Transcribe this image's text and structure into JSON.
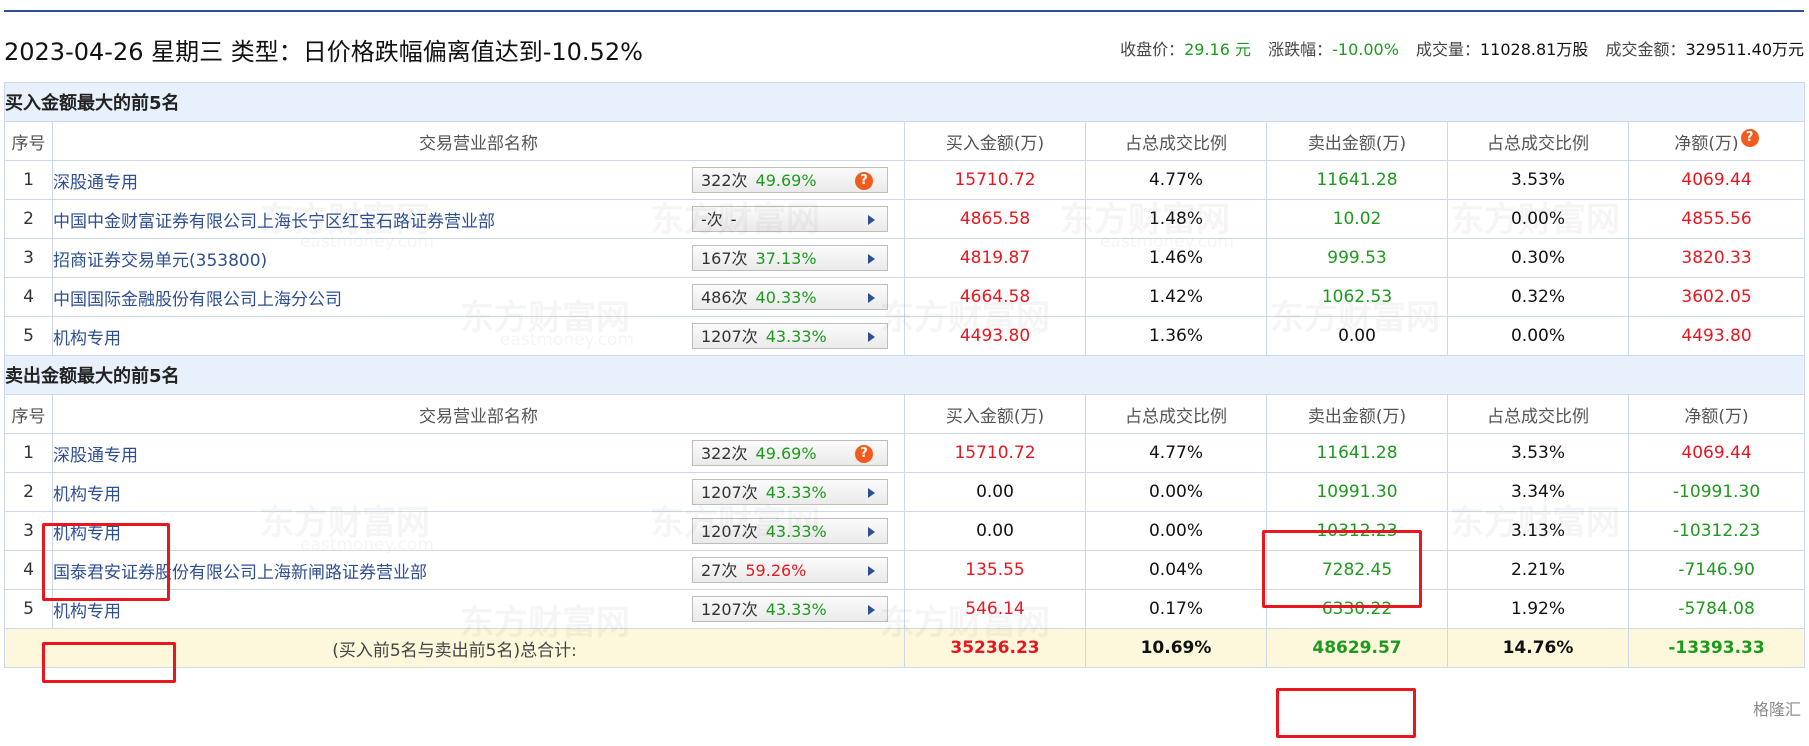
{
  "header": {
    "title": "2023-04-26 星期三 类型：日价格跌幅偏离值达到-10.52%",
    "close_label": "收盘价：",
    "close_value": "29.16 元",
    "change_label": "涨跌幅：",
    "change_value": "-10.00%",
    "volume_label": "成交量：",
    "volume_value": "11028.81万股",
    "amount_label": "成交金额：",
    "amount_value": "329511.40万元"
  },
  "columns": {
    "idx": "序号",
    "name": "交易营业部名称",
    "buy": "买入金额(万)",
    "buy_ratio": "占总成交比例",
    "sell": "卖出金额(万)",
    "sell_ratio": "占总成交比例",
    "net": "净额(万)"
  },
  "buy_section": {
    "title": "买入金额最大的前5名",
    "rows": [
      {
        "idx": "1",
        "name": "深股通专用",
        "count": "322次",
        "rate": "49.69%",
        "buy": "15710.72",
        "buy_ratio": "4.77%",
        "sell": "11641.28",
        "sell_ratio": "3.53%",
        "net": "4069.44"
      },
      {
        "idx": "2",
        "name": "中国中金财富证券有限公司上海长宁区红宝石路证券营业部",
        "count": "-次",
        "rate": "-",
        "buy": "4865.58",
        "buy_ratio": "1.48%",
        "sell": "10.02",
        "sell_ratio": "0.00%",
        "net": "4855.56"
      },
      {
        "idx": "3",
        "name": "招商证券交易单元(353800)",
        "count": "167次",
        "rate": "37.13%",
        "buy": "4819.87",
        "buy_ratio": "1.46%",
        "sell": "999.53",
        "sell_ratio": "0.30%",
        "net": "3820.33"
      },
      {
        "idx": "4",
        "name": "中国国际金融股份有限公司上海分公司",
        "count": "486次",
        "rate": "40.33%",
        "buy": "4664.58",
        "buy_ratio": "1.42%",
        "sell": "1062.53",
        "sell_ratio": "0.32%",
        "net": "3602.05"
      },
      {
        "idx": "5",
        "name": "机构专用",
        "count": "1207次",
        "rate": "43.33%",
        "buy": "4493.80",
        "buy_ratio": "1.36%",
        "sell": "0.00",
        "sell_ratio": "0.00%",
        "net": "4493.80"
      }
    ]
  },
  "sell_section": {
    "title": "卖出金额最大的前5名",
    "rows": [
      {
        "idx": "1",
        "name": "深股通专用",
        "count": "322次",
        "rate": "49.69%",
        "buy": "15710.72",
        "buy_ratio": "4.77%",
        "sell": "11641.28",
        "sell_ratio": "3.53%",
        "net": "4069.44"
      },
      {
        "idx": "2",
        "name": "机构专用",
        "count": "1207次",
        "rate": "43.33%",
        "buy": "0.00",
        "buy_ratio": "0.00%",
        "sell": "10991.30",
        "sell_ratio": "3.34%",
        "net": "-10991.30"
      },
      {
        "idx": "3",
        "name": "机构专用",
        "count": "1207次",
        "rate": "43.33%",
        "buy": "0.00",
        "buy_ratio": "0.00%",
        "sell": "10312.23",
        "sell_ratio": "3.13%",
        "net": "-10312.23"
      },
      {
        "idx": "4",
        "name": "国泰君安证券股份有限公司上海新闸路证券营业部",
        "count": "27次",
        "rate": "59.26%",
        "buy": "135.55",
        "buy_ratio": "0.04%",
        "sell": "7282.45",
        "sell_ratio": "2.21%",
        "net": "-7146.90"
      },
      {
        "idx": "5",
        "name": "机构专用",
        "count": "1207次",
        "rate": "43.33%",
        "buy": "546.14",
        "buy_ratio": "0.17%",
        "sell": "6330.22",
        "sell_ratio": "1.92%",
        "net": "-5784.08"
      }
    ]
  },
  "total": {
    "label": "(买入前5名与卖出前5名)总合计:",
    "buy": "35236.23",
    "buy_ratio": "10.69%",
    "sell": "48629.57",
    "sell_ratio": "14.76%",
    "net": "-13393.33"
  },
  "icons": {
    "question": "question-icon",
    "arrow": "arrow-right-icon"
  },
  "colors": {
    "positive": "#e8171f",
    "negative": "#1d9a1d",
    "link": "#2f4f94",
    "highlight": "#e8171f"
  },
  "watermark": {
    "brand": "东方财富网",
    "domain": "eastmoney.com",
    "corner": "格隆汇"
  }
}
